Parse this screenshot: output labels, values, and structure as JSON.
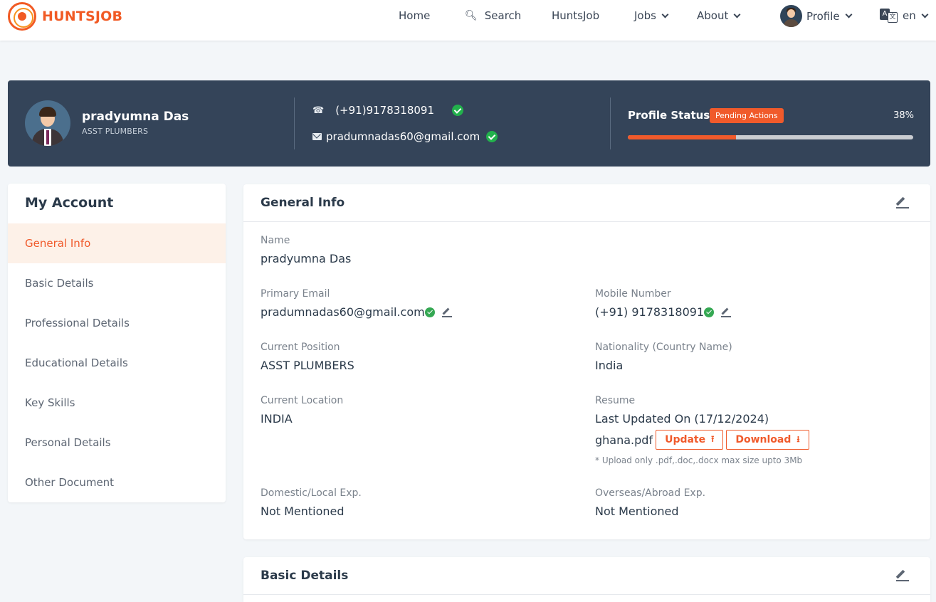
{
  "nav": {
    "brand": "HUNTSJOB",
    "home": "Home",
    "search": "Search",
    "huntsjob": "HuntsJob",
    "jobs": "Jobs",
    "about": "About",
    "profile": "Profile",
    "lang": "en"
  },
  "banner": {
    "name": "pradyumna Das",
    "role": "ASST PLUMBERS",
    "phone": "(+91)9178318091",
    "email": "pradumnadas60@gmail.com",
    "status_title": "Profile Status",
    "status_badge": "Pending Actions",
    "status_percent_label": "38%",
    "progress_fraction": 0.38,
    "accent_color": "#f05a2b"
  },
  "sidebar": {
    "title": "My Account",
    "items": [
      {
        "label": "General Info",
        "active": true
      },
      {
        "label": "Basic Details",
        "active": false
      },
      {
        "label": "Professional Details",
        "active": false
      },
      {
        "label": "Educational Details",
        "active": false
      },
      {
        "label": "Key Skills",
        "active": false
      },
      {
        "label": "Personal Details",
        "active": false
      },
      {
        "label": "Other Document",
        "active": false
      }
    ]
  },
  "general_info": {
    "title": "General Info",
    "name_label": "Name",
    "name_value": "pradyumna Das",
    "email_label": "Primary Email",
    "email_value": "pradumnadas60@gmail.com",
    "mobile_label": "Mobile Number",
    "mobile_value": "(+91) 9178318091",
    "position_label": "Current Position",
    "position_value": "ASST PLUMBERS",
    "nationality_label": "Nationality (Country Name)",
    "nationality_value": "India",
    "location_label": "Current Location",
    "location_value": "INDIA",
    "resume_label": "Resume",
    "resume_updated": "Last Updated On (17/12/2024)",
    "resume_file": "ghana.pdf",
    "update_button": "Update",
    "download_button": "Download",
    "upload_hint": "* Upload only .pdf,.doc,.docx max size upto 3Mb",
    "domestic_label": "Domestic/Local Exp.",
    "domestic_value": "Not Mentioned",
    "overseas_label": "Overseas/Abroad Exp.",
    "overseas_value": "Not Mentioned"
  },
  "basic_details": {
    "title": "Basic Details"
  }
}
